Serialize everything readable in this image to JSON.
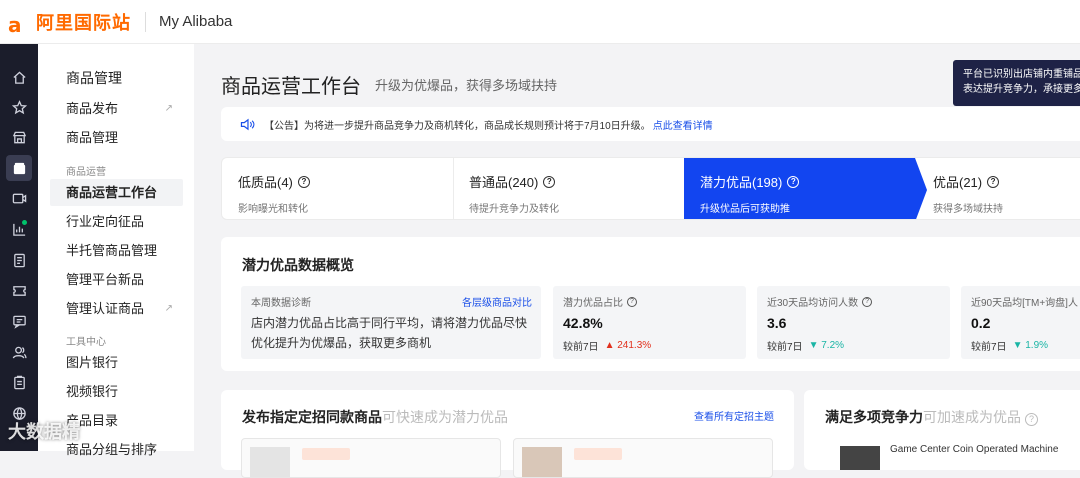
{
  "topbar": {
    "logo_glyph": "a",
    "logo_text": "阿里国际站",
    "app_title": "My Alibaba",
    "brand_color": "#ff6a00"
  },
  "iconbar": {
    "icons": [
      "home-icon",
      "star-icon",
      "store-icon",
      "package-icon",
      "video-icon",
      "chart-icon",
      "report-icon",
      "ticket-icon",
      "message-icon",
      "users-icon",
      "clipboard-icon",
      "globe-icon"
    ],
    "active": "package-icon"
  },
  "sidebar": {
    "header": "商品管理",
    "items": [
      {
        "label": "商品发布",
        "ext": "↗"
      },
      {
        "label": "商品管理"
      }
    ],
    "group1": "商品运营",
    "group1_items": [
      {
        "label": "商品运营工作台"
      },
      {
        "label": "行业定向征品"
      },
      {
        "label": "半托管商品管理"
      },
      {
        "label": "管理平台新品"
      },
      {
        "label": "管理认证商品",
        "ext": "↗"
      }
    ],
    "group2": "工具中心",
    "group2_items": [
      {
        "label": "图片银行"
      },
      {
        "label": "视频银行"
      },
      {
        "label": "产品目录"
      },
      {
        "label": "商品分组与排序"
      }
    ]
  },
  "main": {
    "title": "商品运营工作台",
    "subtitle": "升级为优爆品，获得多场域扶持",
    "tooltip_line1": "平台已识别出店铺内重铺品",
    "tooltip_line2": "表达提升竞争力，承接更多",
    "notice": {
      "text": "【公告】为将进一步提升商品竞争力及商机转化，商品成长规则预计将于7月10日升级。",
      "link": "点此查看详情"
    },
    "tabs": [
      {
        "title": "低质品(4)",
        "desc": "影响曝光和转化"
      },
      {
        "title": "普通品(240)",
        "desc": "待提升竞争力及转化"
      },
      {
        "title": "潜力优品(198)",
        "desc": "升级优品后可获助推"
      },
      {
        "title": "优品(21)",
        "desc": "获得多场域扶持"
      }
    ],
    "tab_q": "?",
    "overview": {
      "title": "潜力优品数据概览",
      "diag_label": "本周数据诊断",
      "diag_link": "各层级商品对比",
      "diag_text": "店内潜力优品占比高于同行平均，请将潜力优品尽快优化提升为优爆品，获取更多商机",
      "metrics": [
        {
          "label": "潜力优品占比",
          "value": "42.8%",
          "cmp": "较前7日",
          "change": "▲ 241.3%",
          "dir": "up"
        },
        {
          "label": "近30天品均访问人数",
          "value": "3.6",
          "cmp": "较前7日",
          "change": "▼ 7.2%",
          "dir": "down"
        },
        {
          "label": "近90天品均[TM+询盘]人",
          "value": "0.2",
          "cmp": "较前7日",
          "change": "▼ 1.9%",
          "dir": "down"
        }
      ]
    },
    "panel_left": {
      "title": "发布指定定招同款商品",
      "sub": "可快速成为潜力优品",
      "link": "查看所有定招主题"
    },
    "panel_right": {
      "title": "满足多项竞争力",
      "sub": "可加速成为优品",
      "product": "Game Center Coin Operated Machine"
    }
  },
  "watermark": "大数据精"
}
